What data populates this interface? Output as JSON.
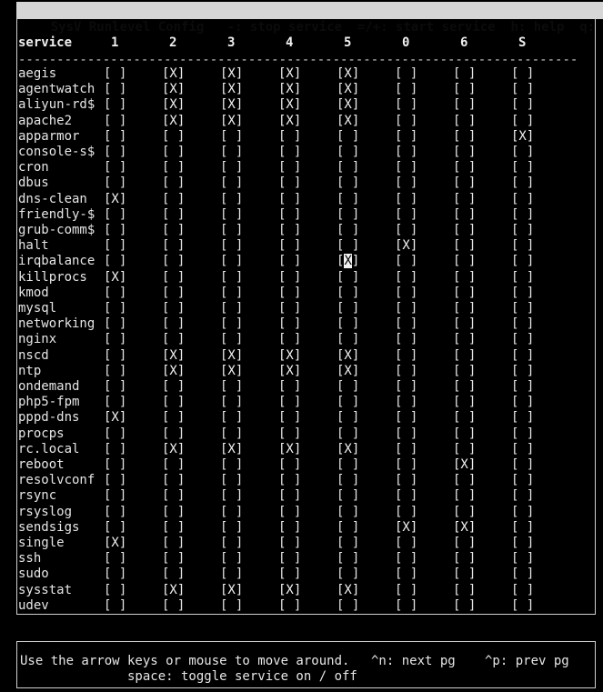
{
  "window": {
    "title_bar": "SysV Runlevel Config   -: stop service  =/+: start service  h: help  q: quit",
    "title": "SysV Runlevel Config",
    "key_stop": "-: stop service",
    "key_start": "=/+: start service",
    "key_help": "h: help",
    "key_quit": "q: quit"
  },
  "table": {
    "name_header": "service",
    "runlevels": [
      "1",
      "2",
      "3",
      "4",
      "5",
      "0",
      "6",
      "S"
    ],
    "separator": "-------------------------------------------------------------------------",
    "checked_glyph": "[X]",
    "unchecked_glyph": "[ ]",
    "cursor": {
      "row": "irqbalance",
      "runlevel": "5",
      "glyph": "X"
    },
    "rows": [
      {
        "service": "aegis",
        "states": [
          "",
          "X",
          "X",
          "X",
          "X",
          "",
          "",
          ""
        ]
      },
      {
        "service": "agentwatch",
        "states": [
          "",
          "X",
          "X",
          "X",
          "X",
          "",
          "",
          ""
        ]
      },
      {
        "service": "aliyun-rd$",
        "states": [
          "",
          "X",
          "X",
          "X",
          "X",
          "",
          "",
          ""
        ]
      },
      {
        "service": "apache2",
        "states": [
          "",
          "X",
          "X",
          "X",
          "X",
          "",
          "",
          ""
        ]
      },
      {
        "service": "apparmor",
        "states": [
          "",
          "",
          "",
          "",
          "",
          "",
          "",
          "X"
        ]
      },
      {
        "service": "console-s$",
        "states": [
          "",
          "",
          "",
          "",
          "",
          "",
          "",
          ""
        ]
      },
      {
        "service": "cron",
        "states": [
          "",
          "",
          "",
          "",
          "",
          "",
          "",
          ""
        ]
      },
      {
        "service": "dbus",
        "states": [
          "",
          "",
          "",
          "",
          "",
          "",
          "",
          ""
        ]
      },
      {
        "service": "dns-clean",
        "states": [
          "X",
          "",
          "",
          "",
          "",
          "",
          "",
          ""
        ]
      },
      {
        "service": "friendly-$",
        "states": [
          "",
          "",
          "",
          "",
          "",
          "",
          "",
          ""
        ]
      },
      {
        "service": "grub-comm$",
        "states": [
          "",
          "",
          "",
          "",
          "",
          "",
          "",
          ""
        ]
      },
      {
        "service": "halt",
        "states": [
          "",
          "",
          "",
          "",
          "",
          "X",
          "",
          ""
        ]
      },
      {
        "service": "irqbalance",
        "states": [
          "",
          "",
          "",
          "",
          "X",
          "",
          "",
          ""
        ]
      },
      {
        "service": "killprocs",
        "states": [
          "X",
          "",
          "",
          "",
          "",
          "",
          "",
          ""
        ]
      },
      {
        "service": "kmod",
        "states": [
          "",
          "",
          "",
          "",
          "",
          "",
          "",
          ""
        ]
      },
      {
        "service": "mysql",
        "states": [
          "",
          "",
          "",
          "",
          "",
          "",
          "",
          ""
        ]
      },
      {
        "service": "networking",
        "states": [
          "",
          "",
          "",
          "",
          "",
          "",
          "",
          ""
        ]
      },
      {
        "service": "nginx",
        "states": [
          "",
          "",
          "",
          "",
          "",
          "",
          "",
          ""
        ]
      },
      {
        "service": "nscd",
        "states": [
          "",
          "X",
          "X",
          "X",
          "X",
          "",
          "",
          ""
        ]
      },
      {
        "service": "ntp",
        "states": [
          "",
          "X",
          "X",
          "X",
          "X",
          "",
          "",
          ""
        ]
      },
      {
        "service": "ondemand",
        "states": [
          "",
          "",
          "",
          "",
          "",
          "",
          "",
          ""
        ]
      },
      {
        "service": "php5-fpm",
        "states": [
          "",
          "",
          "",
          "",
          "",
          "",
          "",
          ""
        ]
      },
      {
        "service": "pppd-dns",
        "states": [
          "X",
          "",
          "",
          "",
          "",
          "",
          "",
          ""
        ]
      },
      {
        "service": "procps",
        "states": [
          "",
          "",
          "",
          "",
          "",
          "",
          "",
          ""
        ]
      },
      {
        "service": "rc.local",
        "states": [
          "",
          "X",
          "X",
          "X",
          "X",
          "",
          "",
          ""
        ]
      },
      {
        "service": "reboot",
        "states": [
          "",
          "",
          "",
          "",
          "",
          "",
          "X",
          ""
        ]
      },
      {
        "service": "resolvconf",
        "states": [
          "",
          "",
          "",
          "",
          "",
          "",
          "",
          ""
        ]
      },
      {
        "service": "rsync",
        "states": [
          "",
          "",
          "",
          "",
          "",
          "",
          "",
          ""
        ]
      },
      {
        "service": "rsyslog",
        "states": [
          "",
          "",
          "",
          "",
          "",
          "",
          "",
          ""
        ]
      },
      {
        "service": "sendsigs",
        "states": [
          "",
          "",
          "",
          "",
          "",
          "X",
          "X",
          ""
        ]
      },
      {
        "service": "single",
        "states": [
          "X",
          "",
          "",
          "",
          "",
          "",
          "",
          ""
        ]
      },
      {
        "service": "ssh",
        "states": [
          "",
          "",
          "",
          "",
          "",
          "",
          "",
          ""
        ]
      },
      {
        "service": "sudo",
        "states": [
          "",
          "",
          "",
          "",
          "",
          "",
          "",
          ""
        ]
      },
      {
        "service": "sysstat",
        "states": [
          "",
          "X",
          "X",
          "X",
          "X",
          "",
          "",
          ""
        ]
      },
      {
        "service": "udev",
        "states": [
          "",
          "",
          "",
          "",
          "",
          "",
          "",
          ""
        ]
      }
    ]
  },
  "help": {
    "line1": "Use the arrow keys or mouse to move around.",
    "next_page": "^n: next pg",
    "prev_page": "^p: prev pg",
    "line2": "space: toggle service on / off"
  },
  "colors": {
    "background": "#000000",
    "foreground": "#e6e6e6",
    "titlebar_bg": "#d6d6d6",
    "titlebar_fg": "#0b0b0b",
    "border": "#cfcfcf",
    "cursor_bg": "#f2f2f2",
    "cursor_fg": "#000000"
  }
}
